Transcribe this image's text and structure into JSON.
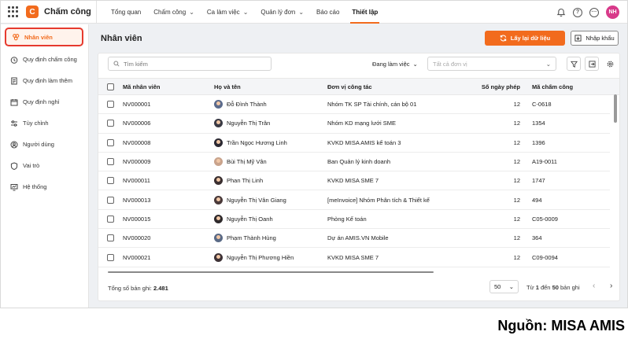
{
  "app": {
    "name": "Chấm công",
    "logo_letter": "C",
    "user_initials": "NH"
  },
  "nav": {
    "items": [
      {
        "label": "Tổng quan",
        "chevron": ""
      },
      {
        "label": "Chấm công",
        "chevron": "⌄"
      },
      {
        "label": "Ca làm việc",
        "chevron": "⌄"
      },
      {
        "label": "Quản lý đơn",
        "chevron": "⌄"
      },
      {
        "label": "Báo cáo",
        "chevron": ""
      },
      {
        "label": "Thiết lập",
        "chevron": ""
      }
    ],
    "active_index": 5
  },
  "sidebar": {
    "items": [
      {
        "label": "Nhân viên",
        "icon": "people-icon",
        "active": true
      },
      {
        "label": "Quy định chấm công",
        "icon": "clock-icon"
      },
      {
        "label": "Quy định làm thêm",
        "icon": "document-icon"
      },
      {
        "label": "Quy định nghỉ",
        "icon": "calendar-icon"
      },
      {
        "label": "Tùy chỉnh",
        "icon": "sliders-icon"
      },
      {
        "label": "Người dùng",
        "icon": "user-icon"
      },
      {
        "label": "Vai trò",
        "icon": "shield-icon"
      },
      {
        "label": "Hệ thống",
        "icon": "system-icon"
      }
    ]
  },
  "page": {
    "title": "Nhân viên",
    "refresh_button": "Lấy lại dữ liệu",
    "import_button": "Nhập khẩu"
  },
  "toolbar": {
    "search_placeholder": "Tìm kiếm",
    "status_filter": "Đang làm việc",
    "unit_placeholder": "Tất cả đơn vị"
  },
  "table": {
    "columns": [
      "Mã nhân viên",
      "Họ và tên",
      "Đơn vị công tác",
      "Số ngày phép",
      "Mã chấm công"
    ],
    "rows": [
      {
        "code": "NV000001",
        "name": "Đỗ Đình Thành",
        "unit": "Nhóm TK SP Tài chính, cán bộ 01",
        "leave": "12",
        "att": "C-0618",
        "avatar": "#5b6b8c"
      },
      {
        "code": "NV000006",
        "name": "Nguyễn Thị Trân",
        "unit": "Nhóm KD mạng lưới SME",
        "leave": "12",
        "att": "1354",
        "avatar": "#3b3b45"
      },
      {
        "code": "NV000008",
        "name": "Trần Ngọc Hương Linh",
        "unit": "KVKD MISA AMIS kế toán 3",
        "leave": "12",
        "att": "1396",
        "avatar": "#2c2a33"
      },
      {
        "code": "NV000009",
        "name": "Bùi Thị Mỹ Vân",
        "unit": "Ban Quản lý kinh doanh",
        "leave": "12",
        "att": "A19-0011",
        "avatar": "#c9a38c"
      },
      {
        "code": "NV000011",
        "name": "Phan Thị Linh",
        "unit": "KVKD MISA SME 7",
        "leave": "12",
        "att": "1747",
        "avatar": "#3a2f30"
      },
      {
        "code": "NV000013",
        "name": "Nguyễn Thị Vân Giang",
        "unit": "[meInvoice] Nhóm Phân tích & Thiết kế",
        "leave": "12",
        "att": "494",
        "avatar": "#4a3a3a"
      },
      {
        "code": "NV000015",
        "name": "Nguyễn Thị Oanh",
        "unit": "Phòng Kế toán",
        "leave": "12",
        "att": "C05-0009",
        "avatar": "#2f2a2c"
      },
      {
        "code": "NV000020",
        "name": "Phạm Thành Hùng",
        "unit": "Dự án AMIS.VN Mobile",
        "leave": "12",
        "att": "364",
        "avatar": "#5a6a86"
      },
      {
        "code": "NV000021",
        "name": "Nguyễn Thị Phương Hiền",
        "unit": "KVKD MISA SME 7",
        "leave": "12",
        "att": "C09-0094",
        "avatar": "#3e3236"
      }
    ]
  },
  "footer": {
    "total_label": "Tổng số bản ghi:",
    "total_value": "2.481",
    "page_size": "50",
    "range_prefix": "Từ",
    "range_from": "1",
    "range_mid": "đến",
    "range_to": "50",
    "range_suffix": "bản ghi"
  },
  "source_caption": "Nguồn: MISA AMIS",
  "colors": {
    "accent": "#f26b1d",
    "highlight_border": "#e63a2e",
    "avatar_user": "#d83a8a"
  }
}
